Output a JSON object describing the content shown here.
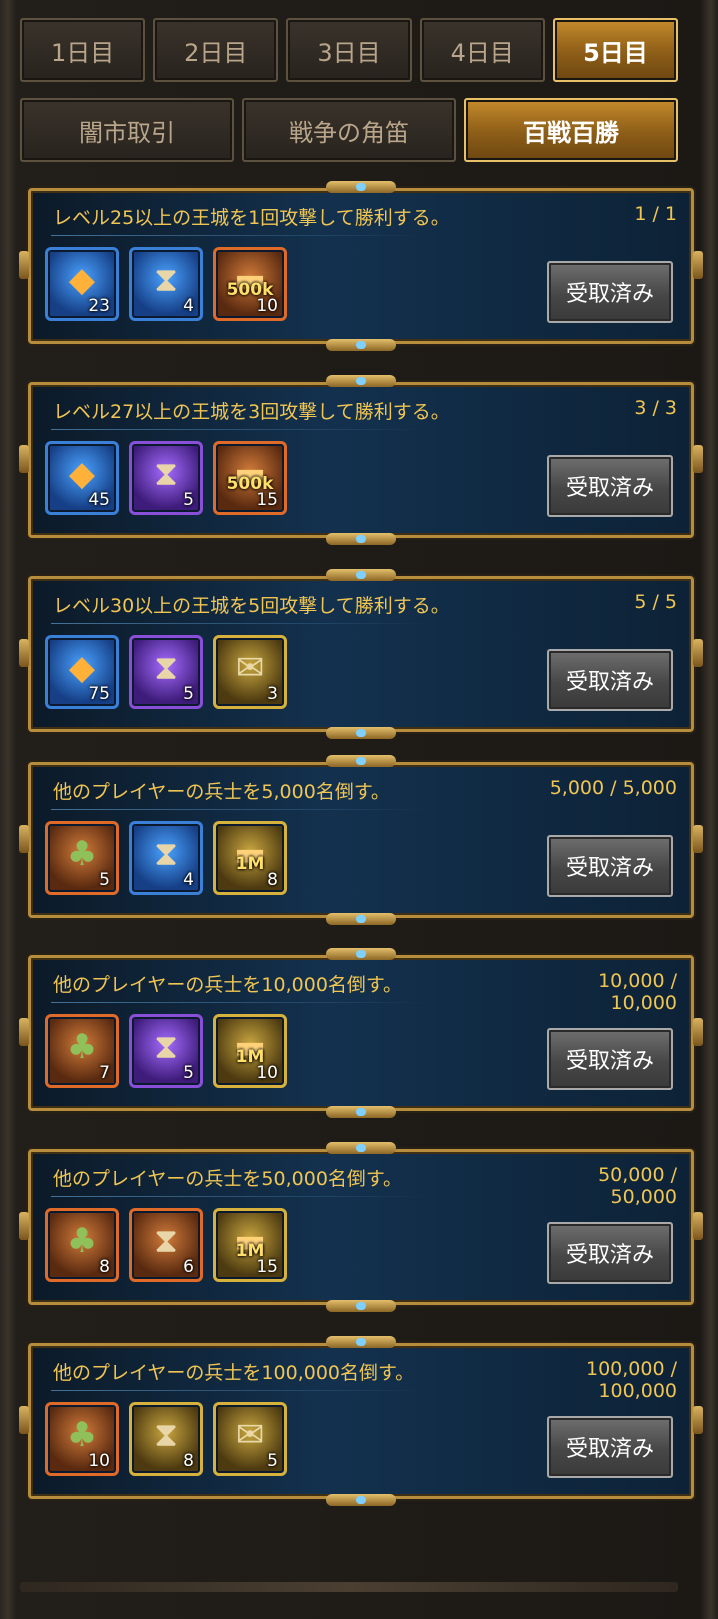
{
  "day_tabs": [
    "1日目",
    "2日目",
    "3日目",
    "4日目",
    "5日目"
  ],
  "active_day": 4,
  "category_tabs": [
    "闇市取引",
    "戦争の角笛",
    "百戦百勝"
  ],
  "active_category": 2,
  "claim_label": "受取済み",
  "missions": [
    {
      "title": "レベル25以上の王城を1回攻撃して勝利する。",
      "progress": "1 / 1",
      "rewards": [
        {
          "icon": "speedup-crystal-icon",
          "count": "23",
          "tier": "blue"
        },
        {
          "icon": "hourglass-icon",
          "count": "4",
          "tier": "blue"
        },
        {
          "icon": "gold-chest-icon",
          "badge": "500k",
          "count": "10",
          "tier": "orange"
        }
      ]
    },
    {
      "title": "レベル27以上の王城を3回攻撃して勝利する。",
      "progress": "3 / 3",
      "rewards": [
        {
          "icon": "speedup-crystal-icon",
          "count": "45",
          "tier": "blue"
        },
        {
          "icon": "hourglass-icon",
          "count": "5",
          "tier": "purple"
        },
        {
          "icon": "gold-chest-icon",
          "badge": "500k",
          "count": "15",
          "tier": "orange"
        }
      ]
    },
    {
      "title": "レベル30以上の王城を5回攻撃して勝利する。",
      "progress": "5 / 5",
      "rewards": [
        {
          "icon": "speedup-crystal-icon",
          "count": "75",
          "tier": "blue"
        },
        {
          "icon": "hourglass-icon",
          "count": "5",
          "tier": "purple"
        },
        {
          "icon": "treasure-map-icon",
          "count": "3",
          "tier": "gold"
        }
      ]
    },
    {
      "title": "他のプレイヤーの兵士を5,000名倒す。",
      "progress": "5,000 / 5,000",
      "rewards": [
        {
          "icon": "gem-bag-icon",
          "count": "5",
          "tier": "orange"
        },
        {
          "icon": "hourglass-icon",
          "count": "4",
          "tier": "blue"
        },
        {
          "icon": "gold-chest-icon",
          "badge": "1M",
          "count": "8",
          "tier": "gold"
        }
      ]
    },
    {
      "title": "他のプレイヤーの兵士を10,000名倒す。",
      "progress": "10,000 /\n10,000",
      "rewards": [
        {
          "icon": "gem-bag-icon",
          "count": "7",
          "tier": "orange"
        },
        {
          "icon": "hourglass-icon",
          "count": "5",
          "tier": "purple"
        },
        {
          "icon": "gold-chest-icon",
          "badge": "1M",
          "count": "10",
          "tier": "gold"
        }
      ]
    },
    {
      "title": "他のプレイヤーの兵士を50,000名倒す。",
      "progress": "50,000 /\n50,000",
      "rewards": [
        {
          "icon": "gem-bag-icon",
          "count": "8",
          "tier": "orange"
        },
        {
          "icon": "hourglass-icon",
          "count": "6",
          "tier": "orange"
        },
        {
          "icon": "gold-chest-icon",
          "badge": "1M",
          "count": "15",
          "tier": "gold"
        }
      ]
    },
    {
      "title": "他のプレイヤーの兵士を100,000名倒す。",
      "progress": "100,000 /\n100,000",
      "rewards": [
        {
          "icon": "gem-bag-icon",
          "count": "10",
          "tier": "orange"
        },
        {
          "icon": "hourglass-icon",
          "count": "8",
          "tier": "gold"
        },
        {
          "icon": "treasure-map-icon",
          "count": "5",
          "tier": "gold"
        }
      ]
    }
  ]
}
